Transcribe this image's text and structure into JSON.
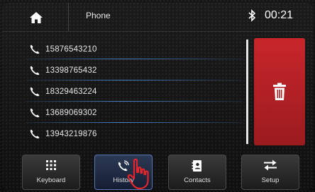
{
  "status": {
    "home_icon": "home-icon",
    "title": "Phone",
    "bluetooth_icon": "bluetooth-icon",
    "clock": "00:21"
  },
  "call_history": [
    {
      "number": "15876543210",
      "icon": "phone-icon"
    },
    {
      "number": "13398765432",
      "icon": "phone-icon"
    },
    {
      "number": "18329463224",
      "icon": "phone-icon"
    },
    {
      "number": "13689069302",
      "icon": "phone-icon"
    },
    {
      "number": "13943219876",
      "icon": "phone-icon"
    }
  ],
  "delete": {
    "icon": "trash-icon",
    "color": "#c7262b"
  },
  "tabs": [
    {
      "label": "Keyboard",
      "icon": "keypad-icon",
      "active": false
    },
    {
      "label": "History",
      "icon": "call-history-icon",
      "active": true
    },
    {
      "label": "Contacts",
      "icon": "contacts-icon",
      "active": false
    },
    {
      "label": "Setup",
      "icon": "setup-arrows-icon",
      "active": false
    }
  ],
  "colors": {
    "accent": "#5b79b8",
    "delete": "#c7262b"
  }
}
